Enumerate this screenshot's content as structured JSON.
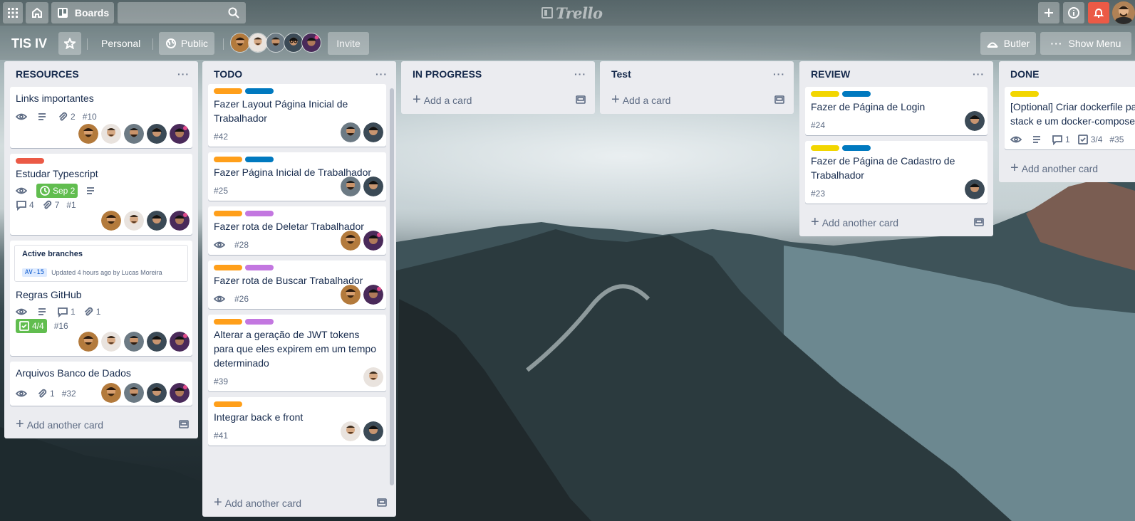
{
  "topbar": {
    "boards_label": "Boards",
    "logo_text": "Trello"
  },
  "board": {
    "title": "TIS IV",
    "team": "Personal",
    "visibility": "Public",
    "invite": "Invite",
    "butler": "Butler",
    "show_menu": "Show Menu"
  },
  "colors": {
    "orange": "#ff9f1a",
    "blue": "#0079bf",
    "purple": "#c377e0",
    "red": "#eb5a46",
    "yellow": "#f2d600",
    "green": "#61bd4f"
  },
  "lists": [
    {
      "name": "RESOURCES",
      "add_card": "Add another card",
      "cards": [
        {
          "title": "Links importantes",
          "badges": {
            "attachments": "2",
            "number": "#10"
          }
        },
        {
          "title": "Estudar Typescript",
          "badges": {
            "due": "Sep 2",
            "comments": "4",
            "attachments": "7",
            "number": "#1"
          }
        },
        {
          "title": "Regras GitHub",
          "branches_title": "Active branches",
          "branch_tag": "AV-15",
          "branch_updated": "Updated 4 hours ago by Lucas Moreira",
          "badges": {
            "comments": "1",
            "attachments": "1",
            "checklist": "4/4",
            "number": "#16"
          }
        },
        {
          "title": "Arquivos Banco de Dados",
          "badges": {
            "attachments": "1",
            "number": "#32"
          }
        }
      ]
    },
    {
      "name": "TODO",
      "add_card": "Add another card",
      "cards": [
        {
          "title": "Fazer Layout Página Inicial de Trabalhador",
          "number": "#42"
        },
        {
          "title": "Fazer Página Inicial de Trabalhador",
          "number": "#25"
        },
        {
          "title": "Fazer rota de Deletar Trabalhador",
          "number": "#28"
        },
        {
          "title": "Fazer rota de Buscar Trabalhador",
          "number": "#26"
        },
        {
          "title": "Alterar a geração de JWT tokens para que eles expirem em um tempo determinado",
          "number": "#39"
        },
        {
          "title": "Integrar back e front",
          "number": "#41"
        }
      ]
    },
    {
      "name": "IN PROGRESS",
      "add_card": "Add a card"
    },
    {
      "name": "Test",
      "add_card": "Add a card"
    },
    {
      "name": "REVIEW",
      "add_card": "Add another card",
      "cards": [
        {
          "title": "Fazer de Página de Login",
          "number": "#24"
        },
        {
          "title": "Fazer de Página de Cadastro de Trabalhador",
          "number": "#23"
        }
      ]
    },
    {
      "name": "DONE",
      "add_card": "Add another card",
      "cards": [
        {
          "title": "[Optional] Criar dockerfile para stack e um docker-compose",
          "badges": {
            "comments": "1",
            "checklist": "3/4",
            "number": "#35"
          }
        }
      ]
    }
  ]
}
